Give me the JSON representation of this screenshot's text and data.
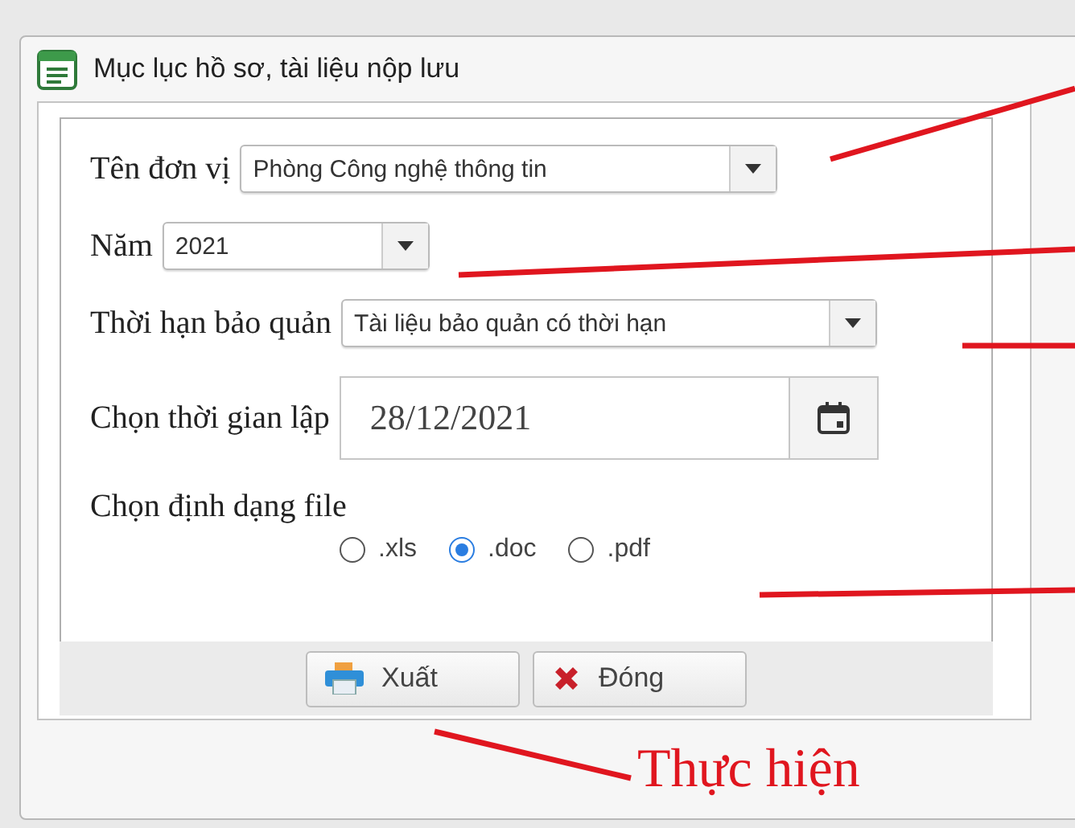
{
  "window": {
    "title": "Mục lục hồ sơ, tài liệu nộp lưu"
  },
  "fields": [
    {
      "kind": "select",
      "label": "Tên đơn vị",
      "value": "Phòng Công nghệ thông tin"
    },
    {
      "kind": "select",
      "label": "Năm",
      "value": "2021"
    },
    {
      "kind": "select",
      "label": "Thời hạn bảo quản",
      "value": "Tài liệu bảo quản có thời hạn"
    },
    {
      "kind": "date",
      "label": "Chọn thời gian lập",
      "value": "28/12/2021"
    }
  ],
  "file_format": {
    "label": "Chọn định dạng file",
    "options": [
      {
        "label": ".xls",
        "selected": false
      },
      {
        "label": ".doc",
        "selected": true
      },
      {
        "label": ".pdf",
        "selected": false
      }
    ]
  },
  "buttons": [
    {
      "kind": "export",
      "label": "Xuất"
    },
    {
      "kind": "close",
      "label": "Đóng"
    }
  ],
  "annotation": "Thực hiện"
}
